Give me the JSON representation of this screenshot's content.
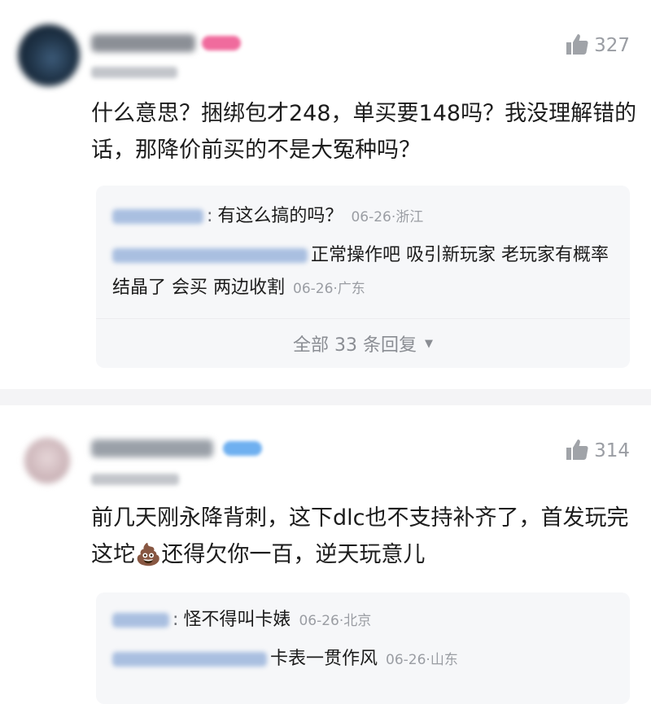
{
  "comments": [
    {
      "likes": "327",
      "text": "什么意思？捆绑包才248，单买要148吗？我没理解错的话，那降价前买的不是大冤种吗？",
      "replies": [
        {
          "text": "有这么搞的吗？",
          "time": "06-26·浙江"
        },
        {
          "text": "正常操作吧 吸引新玩家 老玩家有概率结晶了 会买 两边收割",
          "time": "06-26·广东"
        }
      ],
      "show_all": "全部 33 条回复"
    },
    {
      "likes": "314",
      "text_before": "前几天刚永降背刺，这下dlc也不支持补齐了，首发玩完这坨",
      "emoji": "💩",
      "text_after": "还得欠你一百，逆天玩意儿",
      "replies": [
        {
          "text": "怪不得叫卡婊",
          "time": "06-26·北京"
        },
        {
          "text": "卡表一贯作风",
          "time": "06-26·山东"
        }
      ]
    }
  ],
  "colors": {
    "text": "#1c1c1c",
    "muted": "#9a9da3",
    "reply_bg": "#f6f7f9"
  },
  "icons": {
    "like": "thumbs-up-icon",
    "expand": "caret-down-icon"
  }
}
